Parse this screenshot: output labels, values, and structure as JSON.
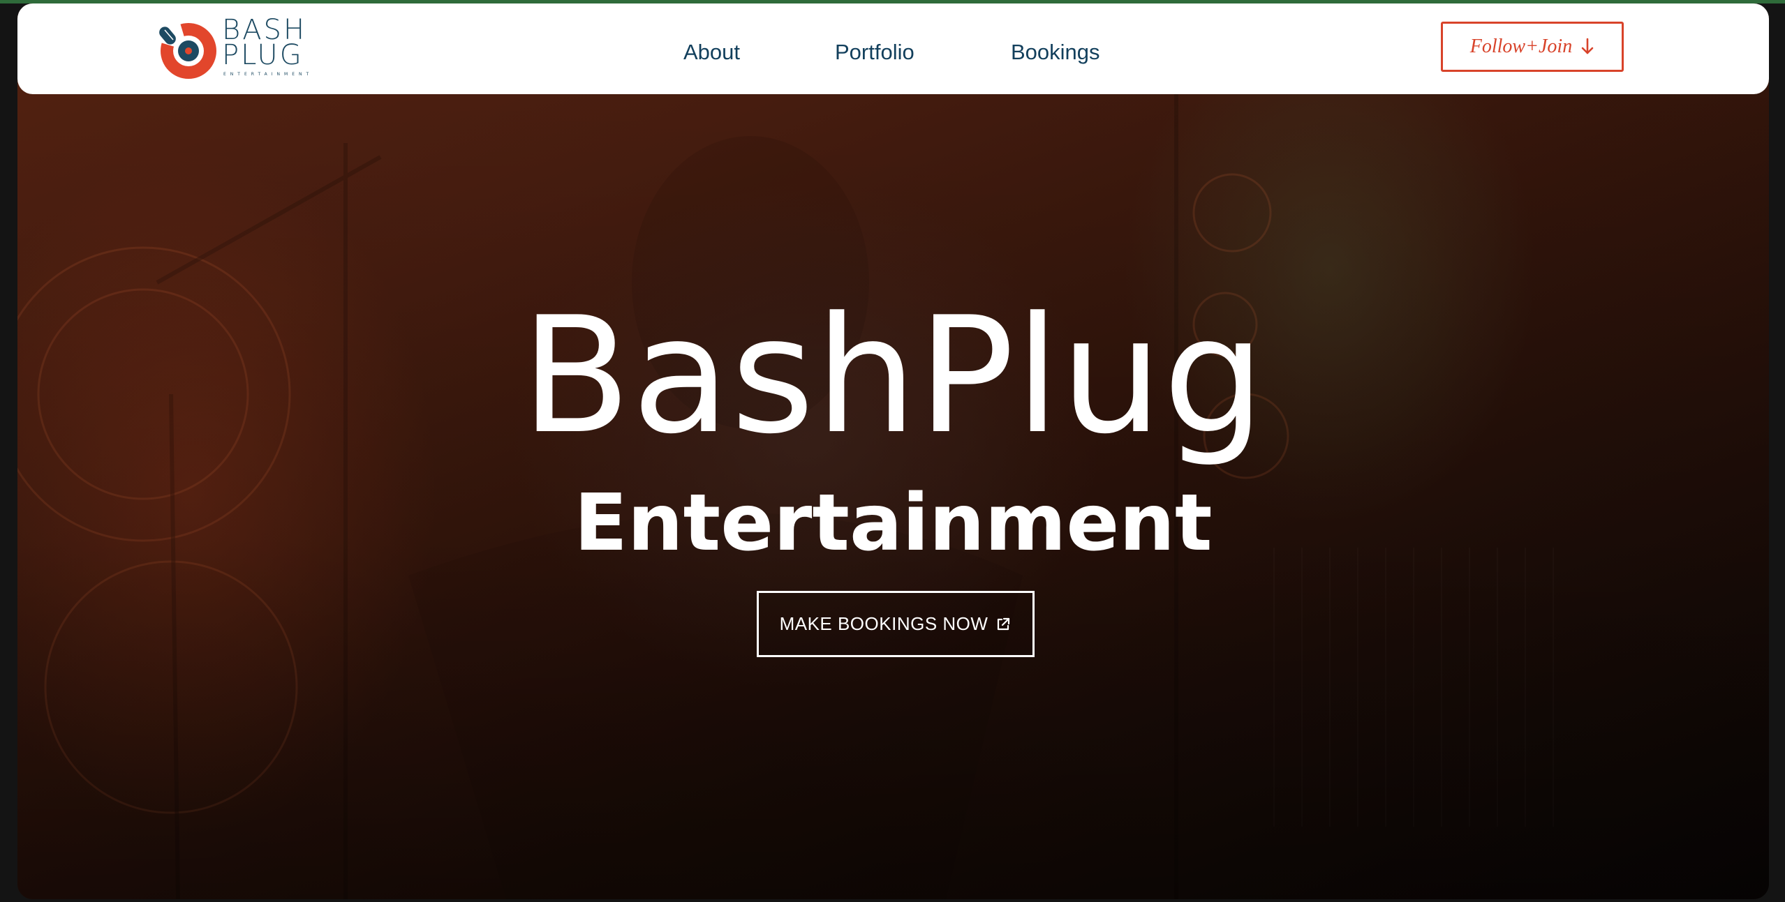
{
  "brand": {
    "logo_line1": "BASH",
    "logo_line2": "PLUG",
    "logo_tagline": "ENTERTAINMENT",
    "primary_color": "#d8432a",
    "secondary_color": "#1d4a62"
  },
  "nav": {
    "links": [
      {
        "label": "About"
      },
      {
        "label": "Portfolio"
      },
      {
        "label": "Bookings"
      }
    ],
    "follow_button": {
      "label": "Follow+Join",
      "icon": "arrow-down-icon"
    }
  },
  "hero": {
    "title": "BashPlug",
    "subtitle": "Entertainment",
    "cta": {
      "label": "MAKE BOOKINGS NOW",
      "icon": "external-link-icon"
    }
  }
}
